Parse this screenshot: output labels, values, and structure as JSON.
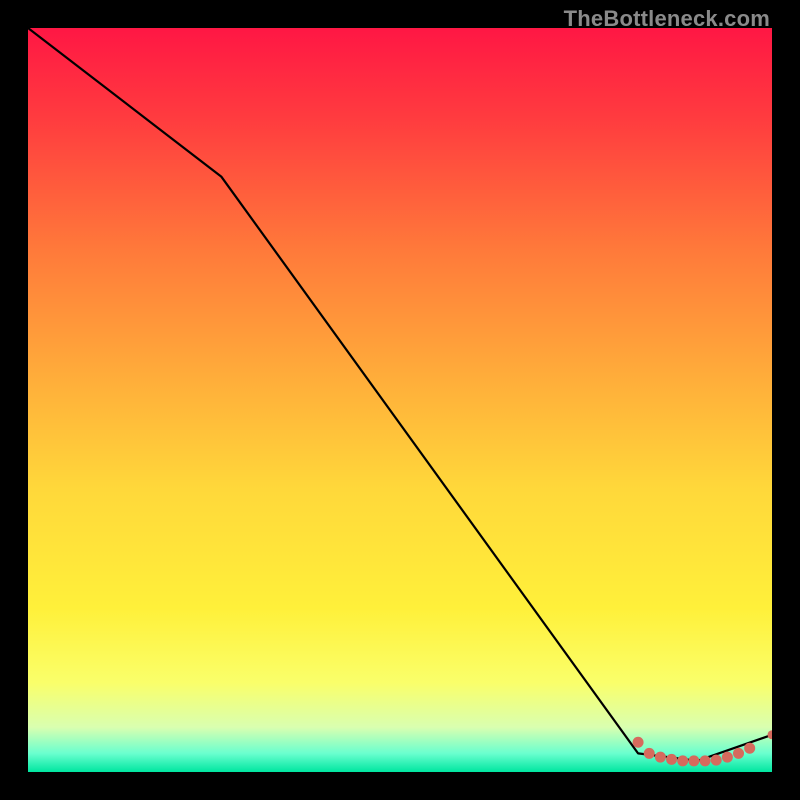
{
  "watermark": "TheBottleneck.com",
  "chart_data": {
    "type": "line",
    "title": "",
    "xlabel": "",
    "ylabel": "",
    "xlim": [
      0,
      100
    ],
    "ylim": [
      0,
      100
    ],
    "series": [
      {
        "name": "curve",
        "x": [
          0,
          26,
          82,
          90,
          100
        ],
        "y": [
          100,
          80,
          2.5,
          1.5,
          5
        ]
      }
    ],
    "markers": [
      {
        "x": 82.0,
        "y": 4.0
      },
      {
        "x": 83.5,
        "y": 2.5
      },
      {
        "x": 85.0,
        "y": 2.0
      },
      {
        "x": 86.5,
        "y": 1.7
      },
      {
        "x": 88.0,
        "y": 1.5
      },
      {
        "x": 89.5,
        "y": 1.5
      },
      {
        "x": 91.0,
        "y": 1.5
      },
      {
        "x": 92.5,
        "y": 1.6
      },
      {
        "x": 94.0,
        "y": 2.0
      },
      {
        "x": 95.5,
        "y": 2.5
      },
      {
        "x": 97.0,
        "y": 3.2
      },
      {
        "x": 100.0,
        "y": 5.0
      }
    ],
    "background_gradient": {
      "stops": [
        {
          "offset": 0.0,
          "color": "#ff1744"
        },
        {
          "offset": 0.12,
          "color": "#ff3b3f"
        },
        {
          "offset": 0.3,
          "color": "#ff7a3a"
        },
        {
          "offset": 0.48,
          "color": "#ffb03a"
        },
        {
          "offset": 0.62,
          "color": "#ffd83a"
        },
        {
          "offset": 0.78,
          "color": "#fff03a"
        },
        {
          "offset": 0.88,
          "color": "#faff6a"
        },
        {
          "offset": 0.94,
          "color": "#d9ffb0"
        },
        {
          "offset": 0.975,
          "color": "#6affcf"
        },
        {
          "offset": 1.0,
          "color": "#00e6a0"
        }
      ]
    },
    "line_color": "#000000",
    "marker_color": "#d66a5d"
  }
}
